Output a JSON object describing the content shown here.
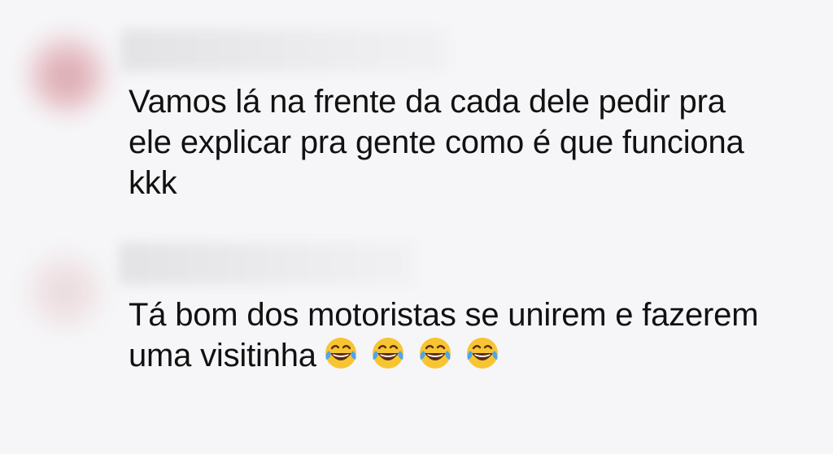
{
  "comments": [
    {
      "lines": [
        "Vamos lá na frente da cada dele pedir pra",
        "ele explicar pra gente como é que funciona",
        "kkk"
      ]
    },
    {
      "lines": [
        "Tá bom dos motoristas se unirem e fazerem",
        "uma visitinha"
      ],
      "emoji": [
        "face-with-tears-of-joy-icon",
        "face-with-tears-of-joy-icon",
        "face-with-tears-of-joy-icon",
        "face-with-tears-of-joy-icon"
      ]
    }
  ],
  "colors": {
    "background": "#f6f6f8",
    "text": "#111111",
    "emoji_face": "#f7c532"
  }
}
